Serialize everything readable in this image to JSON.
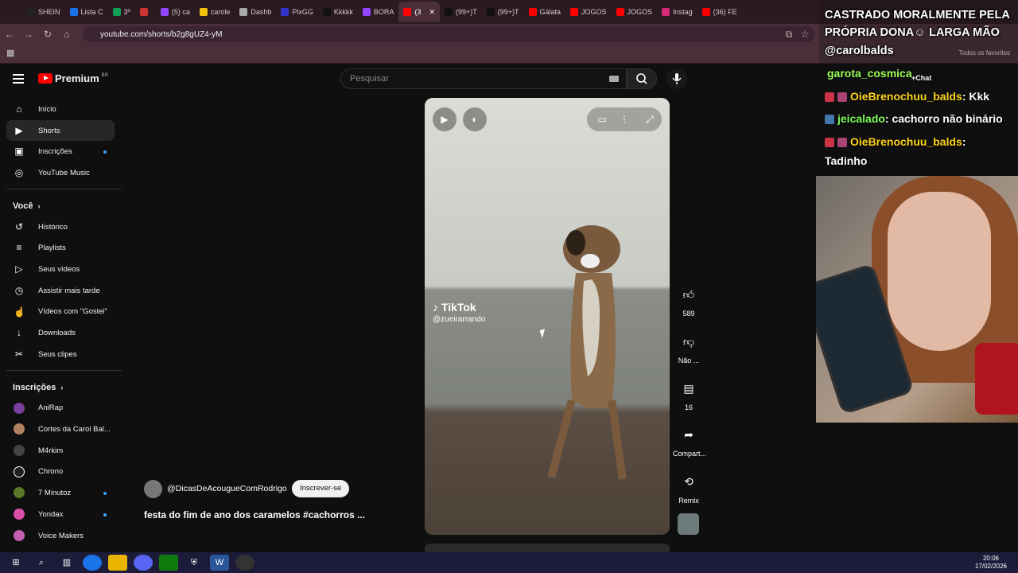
{
  "browser": {
    "tabs": [
      "SHEIN",
      "Lista C",
      "3º",
      "",
      "(5) ca",
      "carole",
      "Dashb",
      "PixGG",
      "Kkkkk",
      "BORA",
      "(3",
      "(99+)T",
      "(99+)T",
      "Gálata",
      "JOGOS",
      "JOGOS",
      "Instag",
      "(36) FE"
    ],
    "url": "youtube.com/shorts/b2g8gUZ4-yM",
    "all_favorites": "Todos os favoritos"
  },
  "yt": {
    "logo_text": "Premium",
    "logo_region": "BR",
    "search_placeholder": "Pesquisar"
  },
  "sidebar": {
    "main": [
      {
        "label": "Início",
        "icon": "home-icon"
      },
      {
        "label": "Shorts",
        "icon": "shorts-icon"
      },
      {
        "label": "Inscrições",
        "icon": "subscriptions-icon"
      },
      {
        "label": "YouTube Music",
        "icon": "music-icon"
      }
    ],
    "you_heading": "Você",
    "you": [
      {
        "label": "Histórico",
        "icon": "history-icon"
      },
      {
        "label": "Playlists",
        "icon": "playlists-icon"
      },
      {
        "label": "Seus vídeos",
        "icon": "your-videos-icon"
      },
      {
        "label": "Assistir mais tarde",
        "icon": "watch-later-icon"
      },
      {
        "label": "Vídeos com \"Gostei\"",
        "icon": "liked-icon"
      },
      {
        "label": "Downloads",
        "icon": "download-icon"
      },
      {
        "label": "Seus clipes",
        "icon": "clips-icon"
      }
    ],
    "subs_heading": "Inscrições",
    "subs": [
      {
        "label": "AniRap"
      },
      {
        "label": "Cortes da Carol Bal..."
      },
      {
        "label": "M4rkim"
      },
      {
        "label": "Chrono"
      },
      {
        "label": "7 Minutoz"
      },
      {
        "label": "Yondax"
      },
      {
        "label": "Voice Makers"
      }
    ]
  },
  "short": {
    "watermark_brand": "TikTok",
    "watermark_user": "@zueirarrando",
    "channel": "@DicasDeAcougueComRodrigo",
    "subscribe": "Inscrever-se",
    "title": "festa do fim de ano dos caramelos #cachorros ...",
    "actions": {
      "likes": "589",
      "dislike": "Não ...",
      "comments": "16",
      "share": "Compart...",
      "remix": "Remix"
    }
  },
  "overlay": {
    "title": "CASTRADO MORALMENTE PELA PRÓPRIA DONA☺ LARGA MÃO",
    "user": "@carolbalds",
    "chat": [
      {
        "user": "garota_cosmica",
        "text": "",
        "color": "#9dff5a"
      },
      {
        "user": "OieBrenochuu_balds",
        "text": ": Kkk",
        "color": "#ffd51a"
      },
      {
        "user": "jeicalado",
        "text": ": cachorro não binário",
        "color": "#7cff5a"
      },
      {
        "user": "OieBrenochuu_balds",
        "text": ":",
        "color": "#ffd51a"
      }
    ],
    "chat_tail": "Tadinho",
    "chat_button": "Chat"
  },
  "taskbar": {
    "time": "20:06",
    "date": "17/02/2026"
  }
}
